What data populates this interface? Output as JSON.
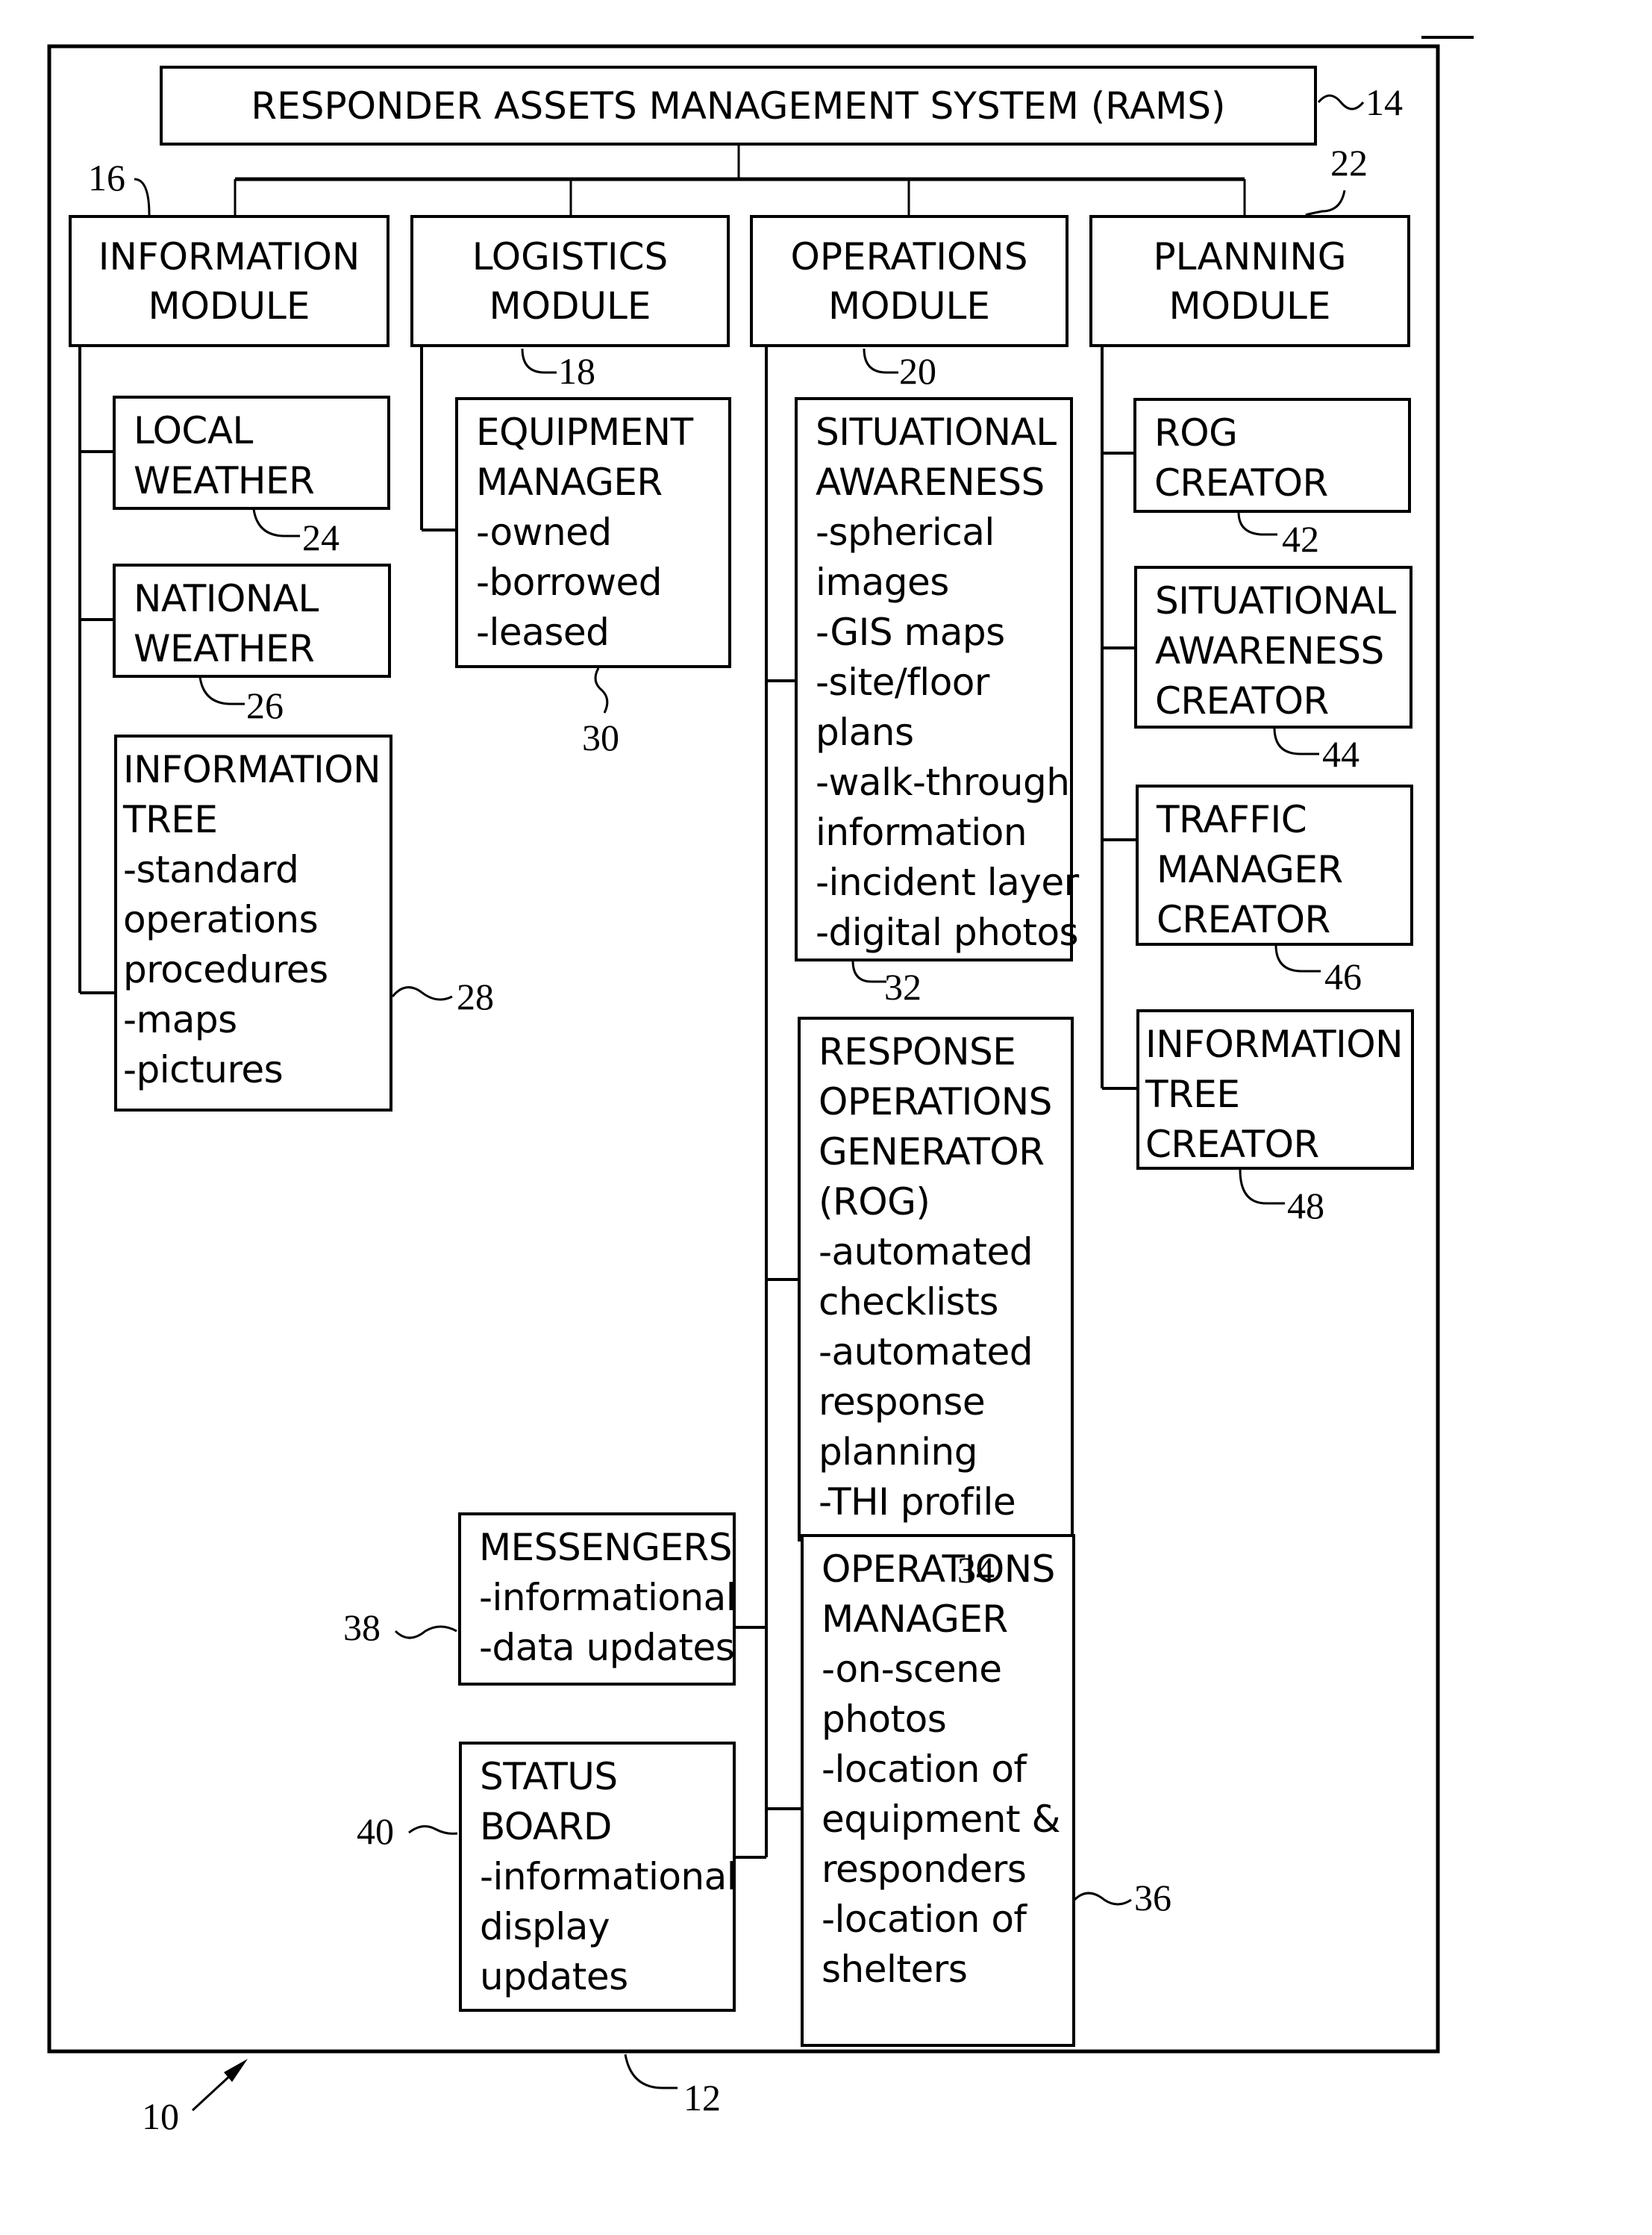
{
  "figure_ref": "10",
  "system_frame_ref": "12",
  "root": {
    "label": "RESPONDER ASSETS MANAGEMENT SYSTEM (RAMS)",
    "ref": "14"
  },
  "modules": [
    {
      "label_lines": [
        "INFORMATION",
        "MODULE"
      ],
      "ref": "16",
      "components": [
        {
          "lines": [
            "LOCAL",
            "WEATHER"
          ],
          "ref": "24"
        },
        {
          "lines": [
            "NATIONAL",
            "WEATHER"
          ],
          "ref": "26"
        },
        {
          "lines": [
            "INFORMATION",
            "TREE",
            "-standard",
            "operations",
            "procedures",
            "-maps",
            "-pictures"
          ],
          "ref": "28"
        }
      ]
    },
    {
      "label_lines": [
        "LOGISTICS",
        "MODULE"
      ],
      "ref": "18",
      "components": [
        {
          "lines": [
            "EQUIPMENT",
            "MANAGER",
            "-owned",
            "-borrowed",
            "-leased"
          ],
          "ref": "30"
        },
        {
          "lines": [
            "MESSENGERS",
            "-informational",
            "-data updates"
          ],
          "ref": "38"
        },
        {
          "lines": [
            "STATUS",
            "BOARD",
            "-informational",
            "display",
            "updates"
          ],
          "ref": "40"
        }
      ]
    },
    {
      "label_lines": [
        "OPERATIONS",
        "MODULE"
      ],
      "ref": "20",
      "components": [
        {
          "lines": [
            "SITUATIONAL",
            "AWARENESS",
            "-spherical",
            "images",
            "-GIS maps",
            "-site/floor",
            "plans",
            "-walk-through",
            "information",
            "-incident layer",
            "-digital photos"
          ],
          "ref": "32"
        },
        {
          "lines": [
            "RESPONSE",
            "OPERATIONS",
            "GENERATOR",
            "(ROG)",
            "-automated",
            "checklists",
            "-automated",
            "response",
            "planning",
            "-THI profile"
          ],
          "ref": "34"
        },
        {
          "lines": [
            "OPERATIONS",
            "MANAGER",
            "-on-scene",
            "photos",
            "-location of",
            "equipment &",
            "responders",
            "-location of",
            "shelters"
          ],
          "ref": "36"
        }
      ]
    },
    {
      "label_lines": [
        "PLANNING",
        "MODULE"
      ],
      "ref": "22",
      "components": [
        {
          "lines": [
            "ROG",
            "CREATOR"
          ],
          "ref": "42"
        },
        {
          "lines": [
            "SITUATIONAL",
            "AWARENESS",
            "CREATOR"
          ],
          "ref": "44"
        },
        {
          "lines": [
            "TRAFFIC",
            "MANAGER",
            "CREATOR"
          ],
          "ref": "46"
        },
        {
          "lines": [
            "INFORMATION",
            "TREE",
            "CREATOR"
          ],
          "ref": "48"
        }
      ]
    }
  ]
}
